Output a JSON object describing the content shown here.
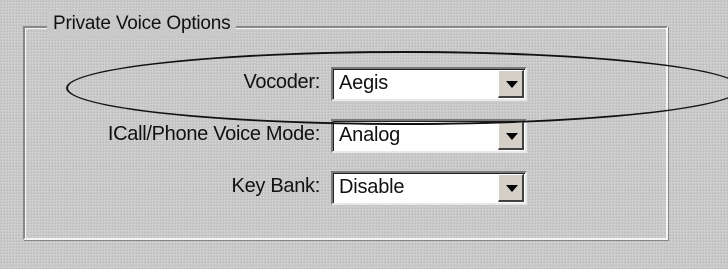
{
  "group": {
    "title": "Private Voice Options"
  },
  "fields": [
    {
      "label": "Vocoder:",
      "value": "Aegis"
    },
    {
      "label": "ICall/Phone Voice Mode:",
      "value": "Analog"
    },
    {
      "label": "Key Bank:",
      "value": "Disable"
    }
  ],
  "icons": {
    "dropdown": "chevron-down-icon"
  },
  "colors": {
    "background": "#c9c9c9",
    "field_background": "#ffffff",
    "text": "#111111",
    "annotation": "#111111"
  }
}
